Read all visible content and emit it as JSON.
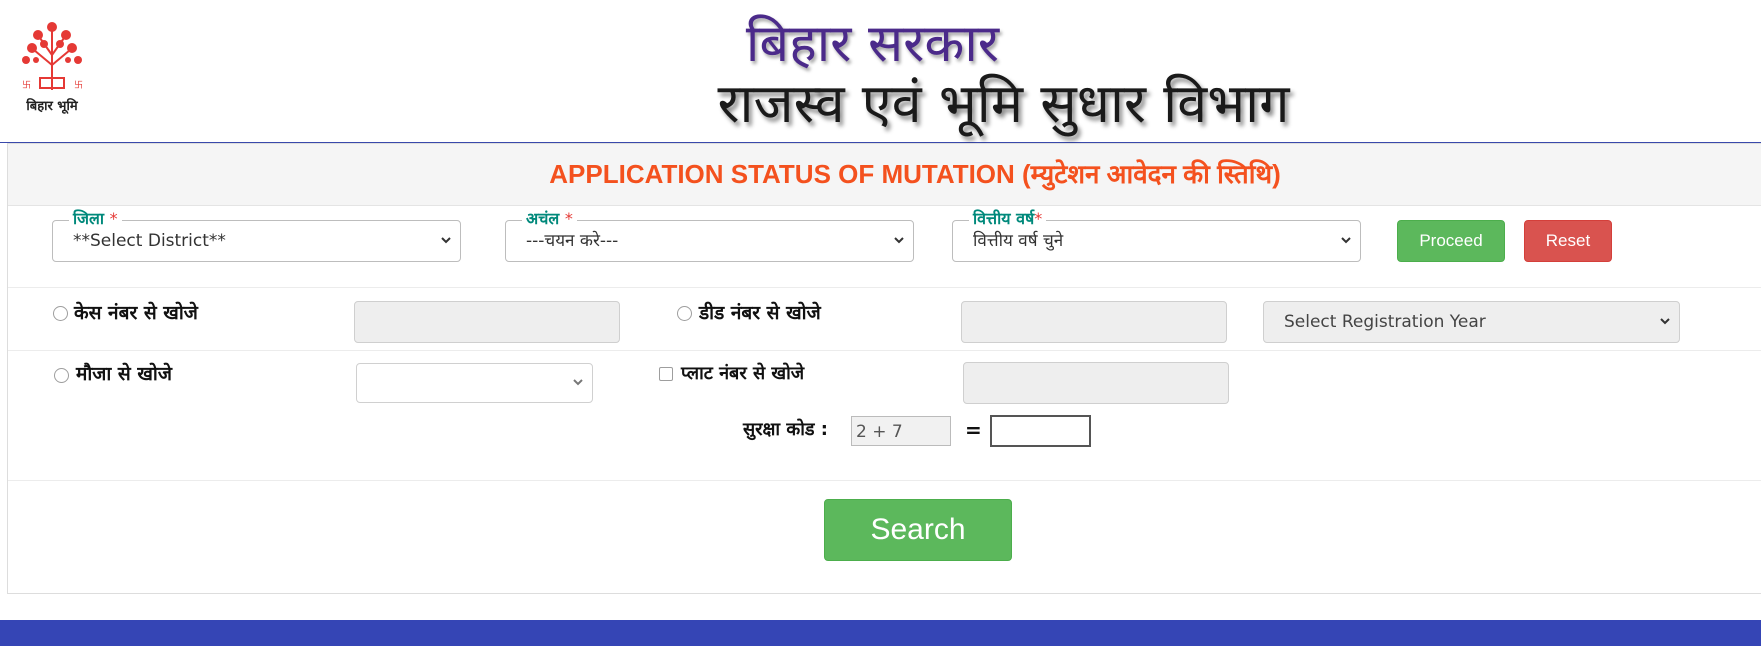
{
  "header": {
    "logo_caption": "बिहार भूमि",
    "gov_title": "बिहार सरकार",
    "dept_title": "राजस्व एवं भूमि सुधार विभाग"
  },
  "page": {
    "heading": "APPLICATION STATUS OF MUTATION (म्युटेशन आवेदन की स्तिथि)"
  },
  "filters": {
    "district": {
      "legend": "जिला",
      "required_mark": "*",
      "value": "**Select District**"
    },
    "circle": {
      "legend": "अचंल",
      "required_mark": "*",
      "value": "---चयन करे---"
    },
    "financial_year": {
      "legend": "वित्तीय वर्ष",
      "required_mark": "*",
      "value": "वित्तीय वर्ष चुने"
    },
    "proceed_label": "Proceed",
    "reset_label": "Reset"
  },
  "search_options": {
    "case_number_label": "केस नंबर से खोजे",
    "deed_number_label": "डीड नंबर से खोजे",
    "registration_year_value": "Select Registration Year",
    "mauja_label": "मौजा से खोजे",
    "plot_number_label": "प्लाट नंबर से खोजे"
  },
  "captcha": {
    "label": "सुरक्षा कोड :",
    "question": "2 + 7",
    "equals": "="
  },
  "actions": {
    "search_label": "Search"
  },
  "colors": {
    "heading": "#f4511e",
    "legend": "#00897b",
    "green_button": "#5cb85c",
    "red_button": "#d9534f",
    "footer": "#3545b5"
  }
}
